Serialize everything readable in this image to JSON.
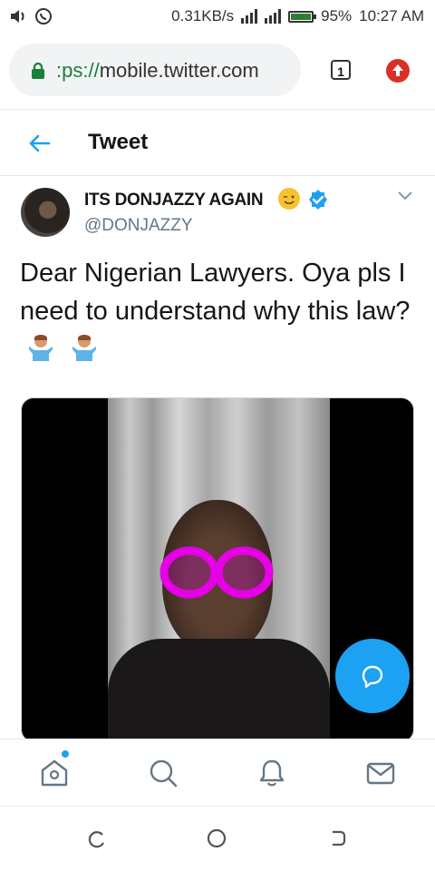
{
  "status_bar": {
    "speed": "0.31KB/s",
    "battery_percent": "95%",
    "time": "10:27 AM",
    "left_icons": [
      "volume-icon",
      "whatsapp-icon"
    ],
    "right_icons": [
      "signal-icon",
      "signal-icon-2",
      "battery-icon"
    ]
  },
  "browser": {
    "url_scheme": ":ps://",
    "url_host": "mobile.twitter.com",
    "tab_count": "1"
  },
  "header": {
    "title": "Tweet"
  },
  "tweet": {
    "author_name": "ITS DONJAZZY AGAIN",
    "author_handle": "@DONJAZZY",
    "text": "Dear Nigerian Lawyers. Oya pls I need to understand why this law?"
  },
  "colors": {
    "twitter_blue": "#1da1f2",
    "text_dark": "#14171a",
    "text_secondary": "#657786",
    "update_red": "#d93025"
  },
  "bottom_nav": {
    "items": [
      "home-icon",
      "search-icon",
      "notifications-icon",
      "messages-icon"
    ]
  },
  "system_nav": {
    "items": [
      "recents-icon",
      "home-circle-icon",
      "back-icon"
    ]
  }
}
